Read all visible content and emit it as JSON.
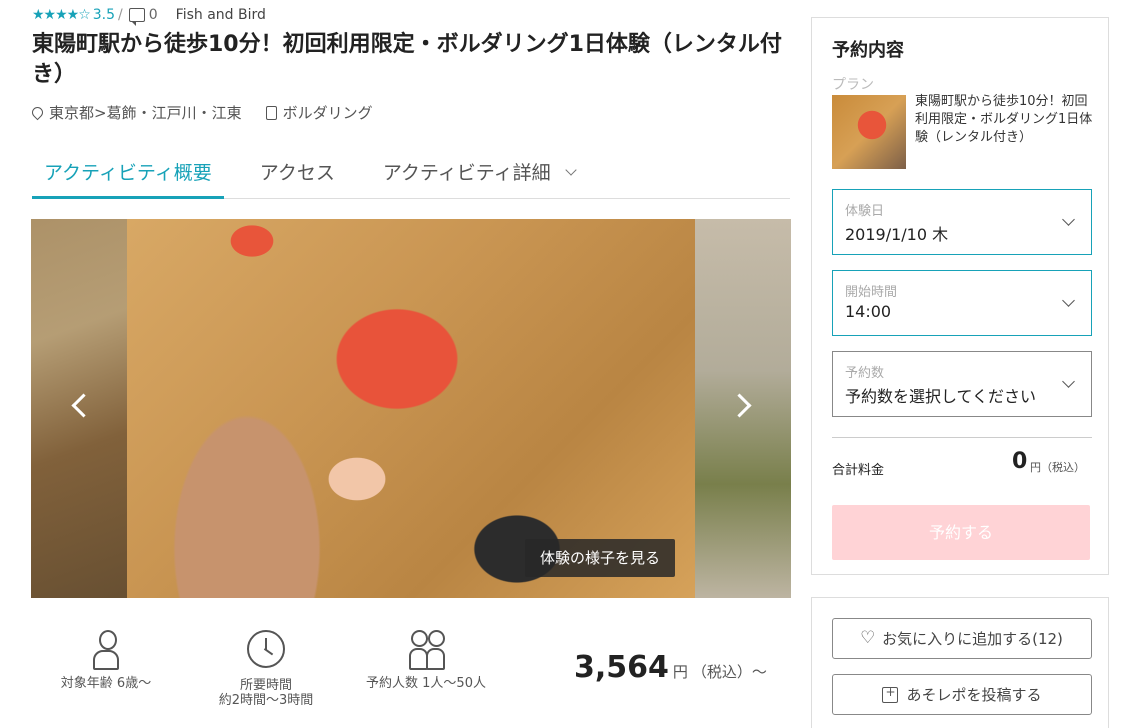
{
  "rating": {
    "stars": "★★★★☆",
    "score": "3.5",
    "separator": "/",
    "comment_count": "0",
    "shop_name": "Fish and Bird"
  },
  "title": "東陽町駅から徒歩10分！初回利用限定・ボルダリング1日体験（レンタル付き）",
  "location": {
    "prefecture": "東京都",
    "arrow": ">",
    "area": "葛飾・江戸川・江東",
    "category": "ボルダリング"
  },
  "tabs": [
    {
      "label": "アクティビティ概要"
    },
    {
      "label": "アクセス"
    },
    {
      "label": "アクティビティ詳細"
    }
  ],
  "gallery": {
    "button_label": "体験の様子を見る"
  },
  "info": {
    "age": {
      "label": "対象年齢 6歳〜"
    },
    "duration": {
      "label": "所要時間",
      "value": "約2時間〜3時間"
    },
    "capacity": {
      "label": "予約人数 1人〜50人"
    }
  },
  "price": {
    "amount": "3,564",
    "unit": "円",
    "tax": "（税込）〜"
  },
  "booking": {
    "title": "予約内容",
    "plan_label": "プラン",
    "plan_name": "東陽町駅から徒歩10分！初回利用限定・ボルダリング1日体験（レンタル付き）",
    "date": {
      "label": "体験日",
      "value": "2019/1/10 木"
    },
    "time": {
      "label": "開始時間",
      "value": "14:00"
    },
    "count": {
      "label": "予約数",
      "value": "予約数を選択してください"
    },
    "total_label": "合計料金",
    "total_amount": "0",
    "total_unit": "円（税込）",
    "reserve_label": "予約する"
  },
  "actions": {
    "favorite_label": "お気に入りに追加する(12)",
    "post_label": "あそレポを投稿する"
  },
  "colors": {
    "accent": "#17a2b8",
    "reserve_disabled": "#ffd3d6"
  }
}
